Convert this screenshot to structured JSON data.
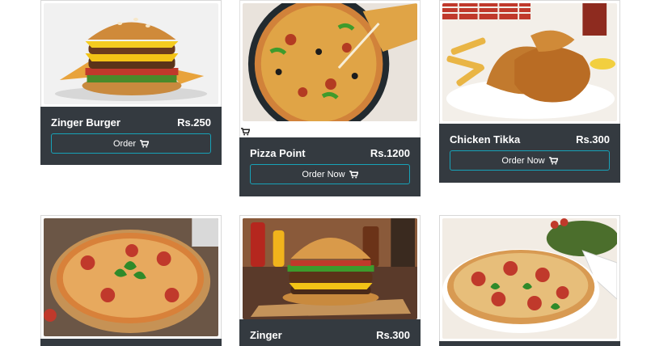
{
  "cards": [
    {
      "name": "Zinger Burger",
      "price": "Rs.250",
      "button": "Order",
      "image": "burger-photo"
    },
    {
      "name": "Pizza Point",
      "price": "Rs.1200",
      "button": "Order Now",
      "image": "pizza-photo"
    },
    {
      "name": "Chicken Tikka",
      "price": "Rs.300",
      "button": "Order Now",
      "image": "fried-chicken-photo"
    },
    {
      "name": "",
      "price": "",
      "button": "",
      "image": "pizza-photo"
    },
    {
      "name": "Zinger",
      "price": "Rs.300",
      "button": "",
      "image": "burger-photo"
    },
    {
      "name": "",
      "price": "",
      "button": "",
      "image": "pizza-photo"
    }
  ],
  "icons": {
    "cart": "cart-icon"
  },
  "colors": {
    "panel": "#343a40",
    "button_border": "#17a2b8"
  }
}
